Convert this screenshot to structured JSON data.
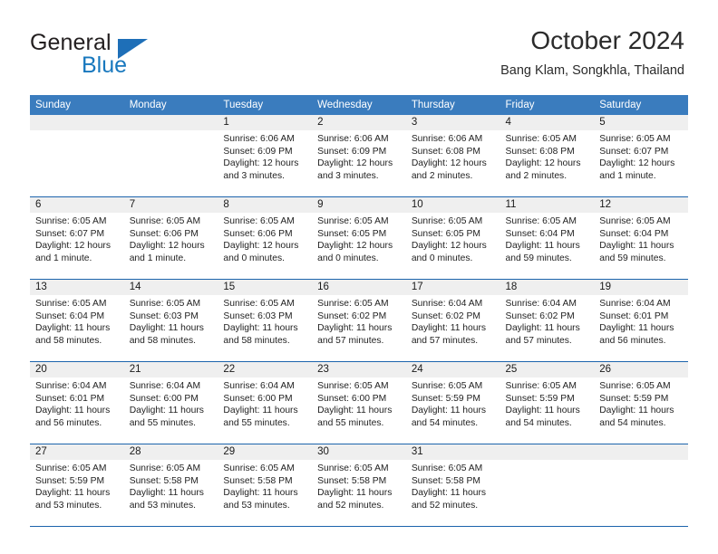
{
  "brand": {
    "name_top": "General",
    "name_bottom": "Blue",
    "flag_icon": "triangle-flag-icon",
    "accent_color": "#1878be"
  },
  "header": {
    "title": "October 2024",
    "subtitle": "Bang Klam, Songkhla, Thailand"
  },
  "calendar": {
    "header_bg": "#3a7cbe",
    "separator_color": "#1c64ac",
    "daynum_band_bg": "#efefef",
    "weekday_headers": [
      "Sunday",
      "Monday",
      "Tuesday",
      "Wednesday",
      "Thursday",
      "Friday",
      "Saturday"
    ],
    "weeks": [
      [
        {
          "day": "",
          "sunrise": "",
          "sunset": "",
          "daylight1": "",
          "daylight2": ""
        },
        {
          "day": "",
          "sunrise": "",
          "sunset": "",
          "daylight1": "",
          "daylight2": ""
        },
        {
          "day": "1",
          "sunrise": "Sunrise: 6:06 AM",
          "sunset": "Sunset: 6:09 PM",
          "daylight1": "Daylight: 12 hours",
          "daylight2": "and 3 minutes."
        },
        {
          "day": "2",
          "sunrise": "Sunrise: 6:06 AM",
          "sunset": "Sunset: 6:09 PM",
          "daylight1": "Daylight: 12 hours",
          "daylight2": "and 3 minutes."
        },
        {
          "day": "3",
          "sunrise": "Sunrise: 6:06 AM",
          "sunset": "Sunset: 6:08 PM",
          "daylight1": "Daylight: 12 hours",
          "daylight2": "and 2 minutes."
        },
        {
          "day": "4",
          "sunrise": "Sunrise: 6:05 AM",
          "sunset": "Sunset: 6:08 PM",
          "daylight1": "Daylight: 12 hours",
          "daylight2": "and 2 minutes."
        },
        {
          "day": "5",
          "sunrise": "Sunrise: 6:05 AM",
          "sunset": "Sunset: 6:07 PM",
          "daylight1": "Daylight: 12 hours",
          "daylight2": "and 1 minute."
        }
      ],
      [
        {
          "day": "6",
          "sunrise": "Sunrise: 6:05 AM",
          "sunset": "Sunset: 6:07 PM",
          "daylight1": "Daylight: 12 hours",
          "daylight2": "and 1 minute."
        },
        {
          "day": "7",
          "sunrise": "Sunrise: 6:05 AM",
          "sunset": "Sunset: 6:06 PM",
          "daylight1": "Daylight: 12 hours",
          "daylight2": "and 1 minute."
        },
        {
          "day": "8",
          "sunrise": "Sunrise: 6:05 AM",
          "sunset": "Sunset: 6:06 PM",
          "daylight1": "Daylight: 12 hours",
          "daylight2": "and 0 minutes."
        },
        {
          "day": "9",
          "sunrise": "Sunrise: 6:05 AM",
          "sunset": "Sunset: 6:05 PM",
          "daylight1": "Daylight: 12 hours",
          "daylight2": "and 0 minutes."
        },
        {
          "day": "10",
          "sunrise": "Sunrise: 6:05 AM",
          "sunset": "Sunset: 6:05 PM",
          "daylight1": "Daylight: 12 hours",
          "daylight2": "and 0 minutes."
        },
        {
          "day": "11",
          "sunrise": "Sunrise: 6:05 AM",
          "sunset": "Sunset: 6:04 PM",
          "daylight1": "Daylight: 11 hours",
          "daylight2": "and 59 minutes."
        },
        {
          "day": "12",
          "sunrise": "Sunrise: 6:05 AM",
          "sunset": "Sunset: 6:04 PM",
          "daylight1": "Daylight: 11 hours",
          "daylight2": "and 59 minutes."
        }
      ],
      [
        {
          "day": "13",
          "sunrise": "Sunrise: 6:05 AM",
          "sunset": "Sunset: 6:04 PM",
          "daylight1": "Daylight: 11 hours",
          "daylight2": "and 58 minutes."
        },
        {
          "day": "14",
          "sunrise": "Sunrise: 6:05 AM",
          "sunset": "Sunset: 6:03 PM",
          "daylight1": "Daylight: 11 hours",
          "daylight2": "and 58 minutes."
        },
        {
          "day": "15",
          "sunrise": "Sunrise: 6:05 AM",
          "sunset": "Sunset: 6:03 PM",
          "daylight1": "Daylight: 11 hours",
          "daylight2": "and 58 minutes."
        },
        {
          "day": "16",
          "sunrise": "Sunrise: 6:05 AM",
          "sunset": "Sunset: 6:02 PM",
          "daylight1": "Daylight: 11 hours",
          "daylight2": "and 57 minutes."
        },
        {
          "day": "17",
          "sunrise": "Sunrise: 6:04 AM",
          "sunset": "Sunset: 6:02 PM",
          "daylight1": "Daylight: 11 hours",
          "daylight2": "and 57 minutes."
        },
        {
          "day": "18",
          "sunrise": "Sunrise: 6:04 AM",
          "sunset": "Sunset: 6:02 PM",
          "daylight1": "Daylight: 11 hours",
          "daylight2": "and 57 minutes."
        },
        {
          "day": "19",
          "sunrise": "Sunrise: 6:04 AM",
          "sunset": "Sunset: 6:01 PM",
          "daylight1": "Daylight: 11 hours",
          "daylight2": "and 56 minutes."
        }
      ],
      [
        {
          "day": "20",
          "sunrise": "Sunrise: 6:04 AM",
          "sunset": "Sunset: 6:01 PM",
          "daylight1": "Daylight: 11 hours",
          "daylight2": "and 56 minutes."
        },
        {
          "day": "21",
          "sunrise": "Sunrise: 6:04 AM",
          "sunset": "Sunset: 6:00 PM",
          "daylight1": "Daylight: 11 hours",
          "daylight2": "and 55 minutes."
        },
        {
          "day": "22",
          "sunrise": "Sunrise: 6:04 AM",
          "sunset": "Sunset: 6:00 PM",
          "daylight1": "Daylight: 11 hours",
          "daylight2": "and 55 minutes."
        },
        {
          "day": "23",
          "sunrise": "Sunrise: 6:05 AM",
          "sunset": "Sunset: 6:00 PM",
          "daylight1": "Daylight: 11 hours",
          "daylight2": "and 55 minutes."
        },
        {
          "day": "24",
          "sunrise": "Sunrise: 6:05 AM",
          "sunset": "Sunset: 5:59 PM",
          "daylight1": "Daylight: 11 hours",
          "daylight2": "and 54 minutes."
        },
        {
          "day": "25",
          "sunrise": "Sunrise: 6:05 AM",
          "sunset": "Sunset: 5:59 PM",
          "daylight1": "Daylight: 11 hours",
          "daylight2": "and 54 minutes."
        },
        {
          "day": "26",
          "sunrise": "Sunrise: 6:05 AM",
          "sunset": "Sunset: 5:59 PM",
          "daylight1": "Daylight: 11 hours",
          "daylight2": "and 54 minutes."
        }
      ],
      [
        {
          "day": "27",
          "sunrise": "Sunrise: 6:05 AM",
          "sunset": "Sunset: 5:59 PM",
          "daylight1": "Daylight: 11 hours",
          "daylight2": "and 53 minutes."
        },
        {
          "day": "28",
          "sunrise": "Sunrise: 6:05 AM",
          "sunset": "Sunset: 5:58 PM",
          "daylight1": "Daylight: 11 hours",
          "daylight2": "and 53 minutes."
        },
        {
          "day": "29",
          "sunrise": "Sunrise: 6:05 AM",
          "sunset": "Sunset: 5:58 PM",
          "daylight1": "Daylight: 11 hours",
          "daylight2": "and 53 minutes."
        },
        {
          "day": "30",
          "sunrise": "Sunrise: 6:05 AM",
          "sunset": "Sunset: 5:58 PM",
          "daylight1": "Daylight: 11 hours",
          "daylight2": "and 52 minutes."
        },
        {
          "day": "31",
          "sunrise": "Sunrise: 6:05 AM",
          "sunset": "Sunset: 5:58 PM",
          "daylight1": "Daylight: 11 hours",
          "daylight2": "and 52 minutes."
        },
        {
          "day": "",
          "sunrise": "",
          "sunset": "",
          "daylight1": "",
          "daylight2": ""
        },
        {
          "day": "",
          "sunrise": "",
          "sunset": "",
          "daylight1": "",
          "daylight2": ""
        }
      ]
    ]
  }
}
